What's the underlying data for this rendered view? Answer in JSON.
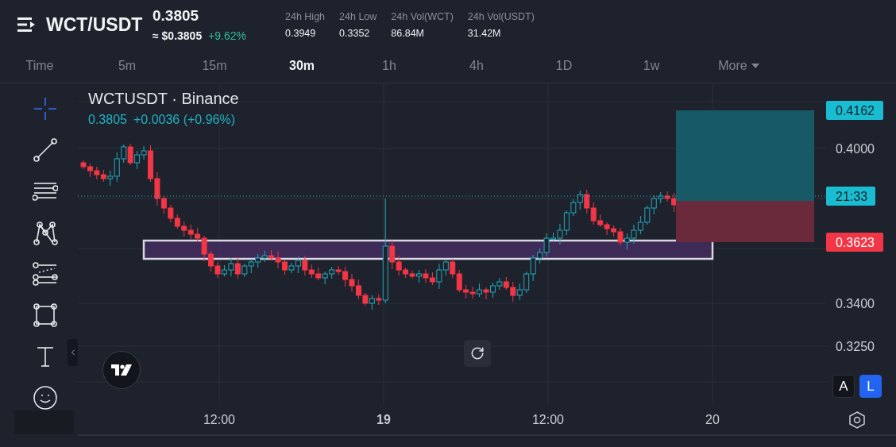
{
  "header": {
    "pair": "WCT/USDT",
    "price": "0.3805",
    "approx": "≈ $0.3805",
    "change": "+9.62%",
    "stats": [
      {
        "label": "24h High",
        "value": "0.3949"
      },
      {
        "label": "24h Low",
        "value": "0.3352"
      },
      {
        "label": "24h Vol(WCT)",
        "value": "86.84M"
      },
      {
        "label": "24h Vol(USDT)",
        "value": "31.42M"
      }
    ]
  },
  "timeframes": [
    {
      "label": "Time",
      "selected": false
    },
    {
      "label": "5m",
      "selected": false
    },
    {
      "label": "15m",
      "selected": false
    },
    {
      "label": "30m",
      "selected": true
    },
    {
      "label": "1h",
      "selected": false
    },
    {
      "label": "4h",
      "selected": false
    },
    {
      "label": "1D",
      "selected": false
    },
    {
      "label": "1w",
      "selected": false
    },
    {
      "label": "More",
      "selected": false,
      "kind": "dropdown"
    }
  ],
  "tools": [
    {
      "kind": "crosshair",
      "selected": true
    },
    {
      "kind": "trendline",
      "selected": false
    },
    {
      "kind": "lines",
      "selected": false
    },
    {
      "kind": "pattern",
      "selected": false
    },
    {
      "kind": "forecast",
      "selected": false
    },
    {
      "kind": "shape",
      "selected": false
    },
    {
      "kind": "text",
      "selected": false
    },
    {
      "kind": "emoji",
      "selected": false
    }
  ],
  "chart": {
    "legend": {
      "symbol": "WCTUSDT · Binance",
      "price": "0.3805",
      "change": "+0.0036 (+0.96%)"
    },
    "price_axis": [
      "0.4000",
      "0.3400",
      "0.3250"
    ],
    "tags": [
      {
        "text": "0.4162",
        "kind": "target"
      },
      {
        "text": "21:33",
        "kind": "countdown"
      },
      {
        "text": "0.3623",
        "kind": "stop"
      }
    ],
    "time_axis": [
      {
        "label": "12:00",
        "bold": false
      },
      {
        "label": "19",
        "bold": true
      },
      {
        "label": "12:00",
        "bold": false
      },
      {
        "label": "20",
        "bold": false
      }
    ],
    "scale_buttons": [
      {
        "label": "A",
        "selected": false
      },
      {
        "label": "L",
        "selected": true
      }
    ]
  }
}
